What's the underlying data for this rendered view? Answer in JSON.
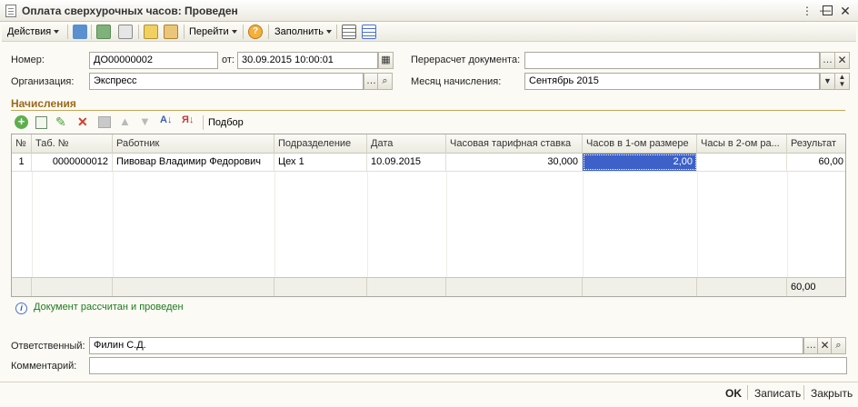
{
  "window": {
    "title": "Оплата сверхурочных часов: Проведен"
  },
  "toolbar": {
    "actions": "Действия",
    "goto": "Перейти",
    "fill": "Заполнить"
  },
  "form": {
    "number_label": "Номер:",
    "number_value": "ДО00000002",
    "date_label": "от:",
    "date_value": "30.09.2015 10:00:01",
    "org_label": "Организация:",
    "org_value": "Экспресс",
    "recalc_label": "Перерасчет документа:",
    "recalc_value": "",
    "month_label": "Месяц начисления:",
    "month_value": "Сентябрь 2015"
  },
  "section": {
    "title": "Начисления"
  },
  "table_toolbar": {
    "selection": "Подбор"
  },
  "table": {
    "columns": [
      "№",
      "Таб. №",
      "Работник",
      "Подразделение",
      "Дата",
      "Часовая тарифная ставка",
      "Часов в 1-ом размере",
      "Часы в 2-ом ра...",
      "Результат"
    ],
    "rows": [
      {
        "n": "1",
        "tab": "0000000012",
        "worker": "Пивовар Владимир Федорович",
        "dept": "Цех 1",
        "date": "10.09.2015",
        "rate": "30,000",
        "hours1": "2,00",
        "hours2": "",
        "result": "60,00"
      }
    ],
    "total_result": "60,00"
  },
  "status": {
    "text": "Документ рассчитан и проведен"
  },
  "footer": {
    "responsible_label": "Ответственный:",
    "responsible_value": "Филин С.Д.",
    "comment_label": "Комментарий:",
    "comment_value": ""
  },
  "buttons": {
    "ok": "OK",
    "save": "Записать",
    "close": "Закрыть"
  },
  "colors": {
    "accent": "#c8a458",
    "selected_cell": "#3d61c9",
    "status_text": "#1e7a1e"
  }
}
